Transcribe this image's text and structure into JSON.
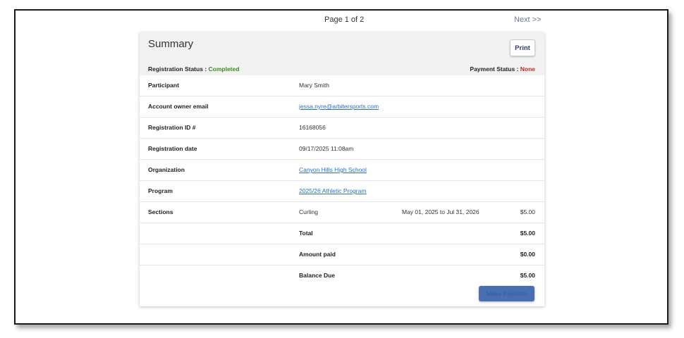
{
  "pager": {
    "page_indicator": "Page 1 of 2",
    "next_label": "Next >>"
  },
  "summary": {
    "title": "Summary",
    "print_label": "Print",
    "registration_status_label": "Registration Status :",
    "registration_status_value": "Completed",
    "payment_status_label": "Payment Status :",
    "payment_status_value": "None"
  },
  "rows": {
    "participant": {
      "label": "Participant",
      "value": "Mary Smith"
    },
    "email": {
      "label": "Account owner email",
      "value": "jessa.nyre@arbitersports.com"
    },
    "reg_id": {
      "label": "Registration ID #",
      "value": "16168056"
    },
    "reg_date": {
      "label": "Registration date",
      "value": "09/17/2025 11:08am"
    },
    "organization": {
      "label": "Organization",
      "value": "Canyon Hills High School"
    },
    "program": {
      "label": "Program",
      "value": "2025/26 Athletic Program"
    },
    "sections": {
      "label": "Sections",
      "value": "Curling",
      "dates": "May 01, 2025 to Jul 31, 2026",
      "amount": "$5.00"
    },
    "total": {
      "label": "Total",
      "amount": "$5.00"
    },
    "amount_paid": {
      "label": "Amount paid",
      "amount": "$0.00"
    },
    "balance_due": {
      "label": "Balance Due",
      "amount": "$5.00"
    }
  },
  "pay_button": {
    "label": "Make Payment"
  },
  "colors": {
    "completed": "#3c8a1e",
    "none": "#c0281b",
    "link": "#2e6fc4",
    "button": "#4a6fae"
  }
}
